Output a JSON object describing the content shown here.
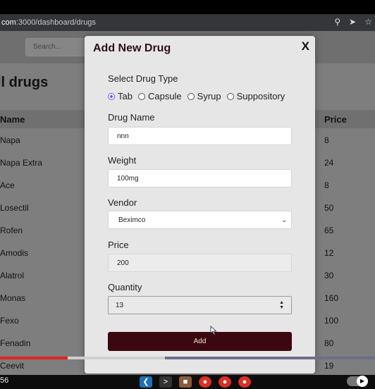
{
  "browser": {
    "url_host_tail": "com",
    "url_path": ":3000/dashboard/drugs",
    "key_icon": "key-icon",
    "send_icon": "send-icon",
    "star_icon": "star-icon"
  },
  "background_page": {
    "search_placeholder": "Search...",
    "heading": "ll drugs",
    "columns": {
      "name": "Name",
      "price": "Price"
    },
    "rows": [
      {
        "name": "Napa",
        "price": "8"
      },
      {
        "name": "Napa Extra",
        "price": "24"
      },
      {
        "name": "Ace",
        "price": "8"
      },
      {
        "name": "Losectil",
        "price": "50"
      },
      {
        "name": "Rofen",
        "price": "65"
      },
      {
        "name": "Amodis",
        "price": "12"
      },
      {
        "name": "Alatrol",
        "price": "30"
      },
      {
        "name": "Monas",
        "price": "160"
      },
      {
        "name": "Fexo",
        "price": "100"
      },
      {
        "name": "Fenadin",
        "price": "80"
      },
      {
        "name": "Ceevit",
        "price": "19"
      }
    ]
  },
  "modal": {
    "title": "Add New Drug",
    "close_label": "X",
    "drug_type_label": "Select Drug Type",
    "drug_types": [
      "Tab",
      "Capsule",
      "Syrup",
      "Suppository"
    ],
    "selected_drug_type": "Tab",
    "drug_name_label": "Drug Name",
    "drug_name_value": "nnn",
    "weight_label": "Weight",
    "weight_value": "100mg",
    "vendor_label": "Vendor",
    "vendor_value": "Beximco",
    "price_label": "Price",
    "price_value": "200",
    "quantity_label": "Quantity",
    "quantity_value": "13",
    "add_button_label": "Add"
  },
  "video": {
    "time_fragment": "56",
    "progress_played": 0.18,
    "progress_buffered": 0.44
  },
  "colors": {
    "accent_button": "#3c070e",
    "radio_selected": "#7b4ce6",
    "progress_red": "#e02424"
  }
}
